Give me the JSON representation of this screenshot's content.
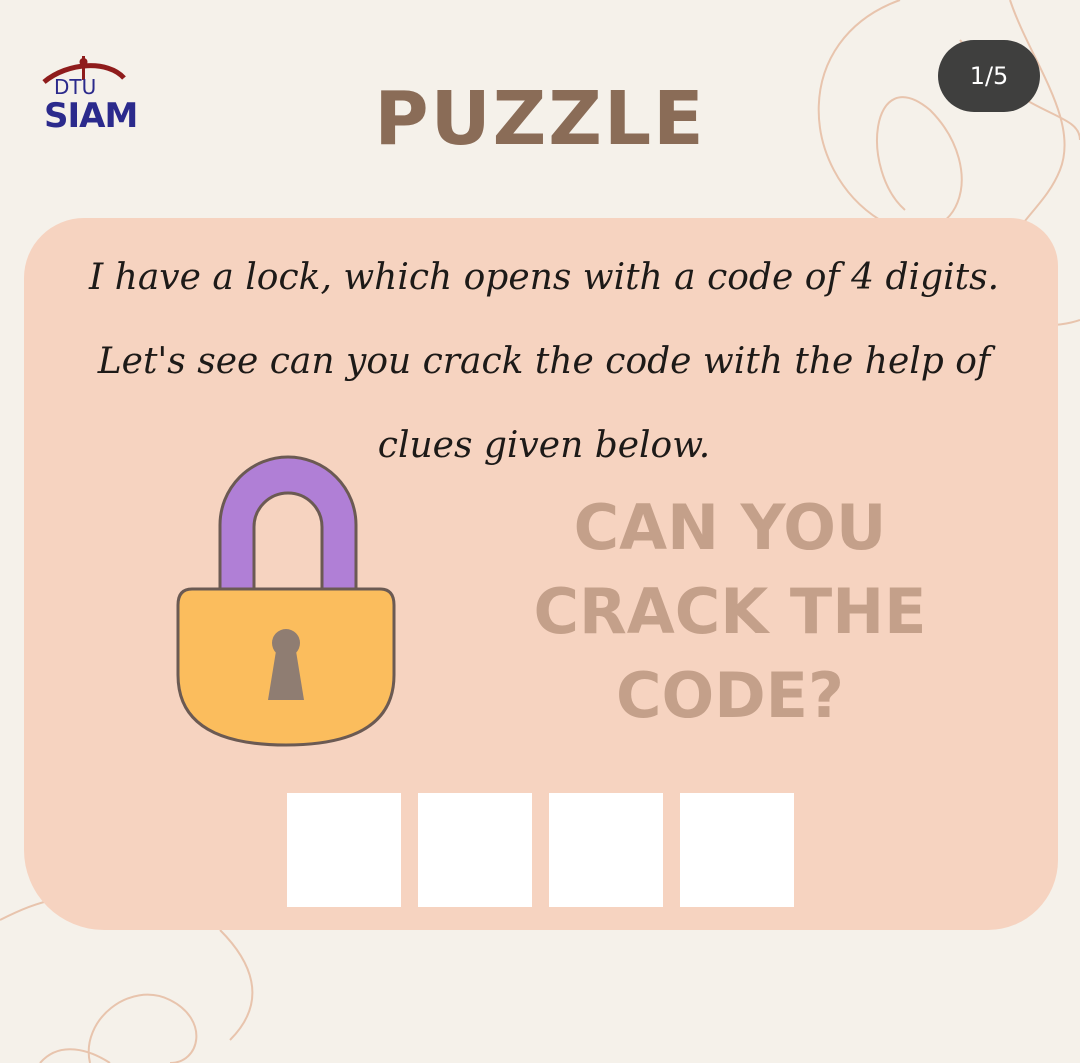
{
  "logo": {
    "top_text": "DTU",
    "bottom_text": "SIAM"
  },
  "header": {
    "title": "PUZZLE",
    "page_indicator": "1/5"
  },
  "clue": {
    "lines": [
      "I have a lock, which opens with a code of 4 digits.",
      "Let's see can you crack the code with the help of",
      "clues given below."
    ]
  },
  "callout": {
    "lines": [
      "CAN YOU",
      "CRACK THE",
      "CODE?"
    ]
  },
  "code_inputs": [
    {
      "value": ""
    },
    {
      "value": ""
    },
    {
      "value": ""
    },
    {
      "value": ""
    }
  ],
  "colors": {
    "background": "#f5f1ea",
    "card": "#f6d3c0",
    "title": "#8a6c57",
    "callout": "#c4a08a",
    "shackle": "#b07fd6",
    "lock_body": "#fbbd5d",
    "keyhole": "#8f7d72",
    "badge": "#3f3f3e"
  },
  "icons": {
    "logo": "dtu-siam-logo",
    "lock": "padlock-icon"
  }
}
